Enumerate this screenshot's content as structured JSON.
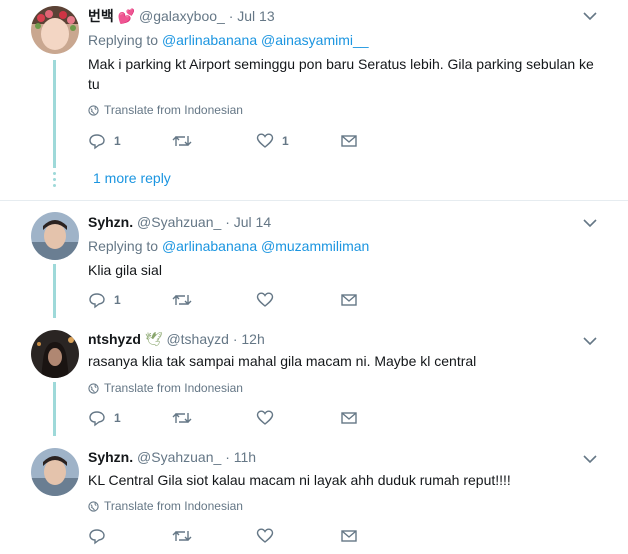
{
  "tweets": [
    {
      "name": "번백",
      "emoji": "💕",
      "handle": "@galaxyboo_",
      "time": "Jul 13",
      "replying_label": "Replying to",
      "replying_to": [
        "@arlinabanana",
        "@ainasyamimi__"
      ],
      "text": "Mak i parking kt Airport seminggu pon baru Seratus lebih. Gila parking sebulan ke tu",
      "translate": "Translate from Indonesian",
      "counts": {
        "reply": "1",
        "retweet": "",
        "like": "1"
      },
      "more_replies": "1 more reply"
    },
    {
      "name": "Syhzn.",
      "handle": "@Syahzuan_",
      "time": "Jul 14",
      "replying_label": "Replying to",
      "replying_to": [
        "@arlinabanana",
        "@muzammiliman"
      ],
      "text": "Klia gila sial",
      "counts": {
        "reply": "1",
        "retweet": "",
        "like": ""
      }
    },
    {
      "name": "ntshyzd",
      "emoji": "🕊",
      "handle": "@tshayzd",
      "time": "12h",
      "text": "rasanya klia tak sampai mahal gila macam ni. Maybe kl central",
      "translate": "Translate from Indonesian",
      "counts": {
        "reply": "1",
        "retweet": "",
        "like": ""
      }
    },
    {
      "name": "Syhzn.",
      "handle": "@Syahzuan_",
      "time": "11h",
      "text": "KL Central Gila siot kalau macam ni layak ahh duduk rumah reput!!!!",
      "translate": "Translate from Indonesian",
      "counts": {
        "reply": "",
        "retweet": "",
        "like": ""
      }
    }
  ],
  "separator": "·",
  "icons": {
    "reply": "reply-icon",
    "retweet": "retweet-icon",
    "like": "heart-icon",
    "dm": "envelope-icon",
    "more": "chevron-down-icon",
    "translate": "globe-icon"
  },
  "colors": {
    "link": "#1b95e0",
    "muted": "#657786",
    "thread": "#9ed9d9"
  }
}
